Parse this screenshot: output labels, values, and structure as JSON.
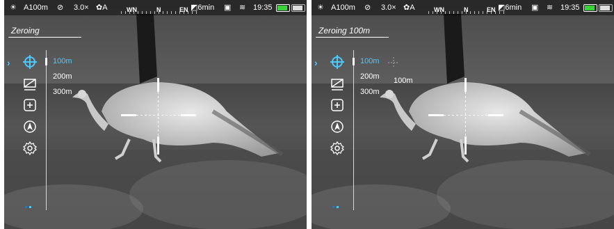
{
  "status_bar": {
    "sun_icon": "sun-icon",
    "zero_profile": "A100m",
    "pip_icon": "pip-icon",
    "zoom": "3.0×",
    "gear_mode": "A",
    "compass": {
      "left": "WN",
      "center": "N",
      "right": "EN"
    },
    "recording_time": "6min",
    "time": "19:35",
    "battery_color": "#3ad13a"
  },
  "panels": [
    {
      "title": "Zeroing",
      "menu": {
        "icons": [
          "crosshair-icon",
          "display-off-icon",
          "plus-square-icon",
          "navigation-icon",
          "settings-gear-icon"
        ],
        "distances": [
          "100m",
          "200m",
          "300m"
        ],
        "selected_distance": "100m"
      }
    },
    {
      "title": "Zeroing 100m",
      "menu": {
        "icons": [
          "crosshair-icon",
          "display-off-icon",
          "plus-square-icon",
          "navigation-icon",
          "settings-gear-icon"
        ],
        "distances": [
          "100m",
          "200m",
          "300m"
        ],
        "selected_distance": "100m"
      },
      "popup_distance": "100m"
    }
  ],
  "accent_color": "#4cc9ff"
}
